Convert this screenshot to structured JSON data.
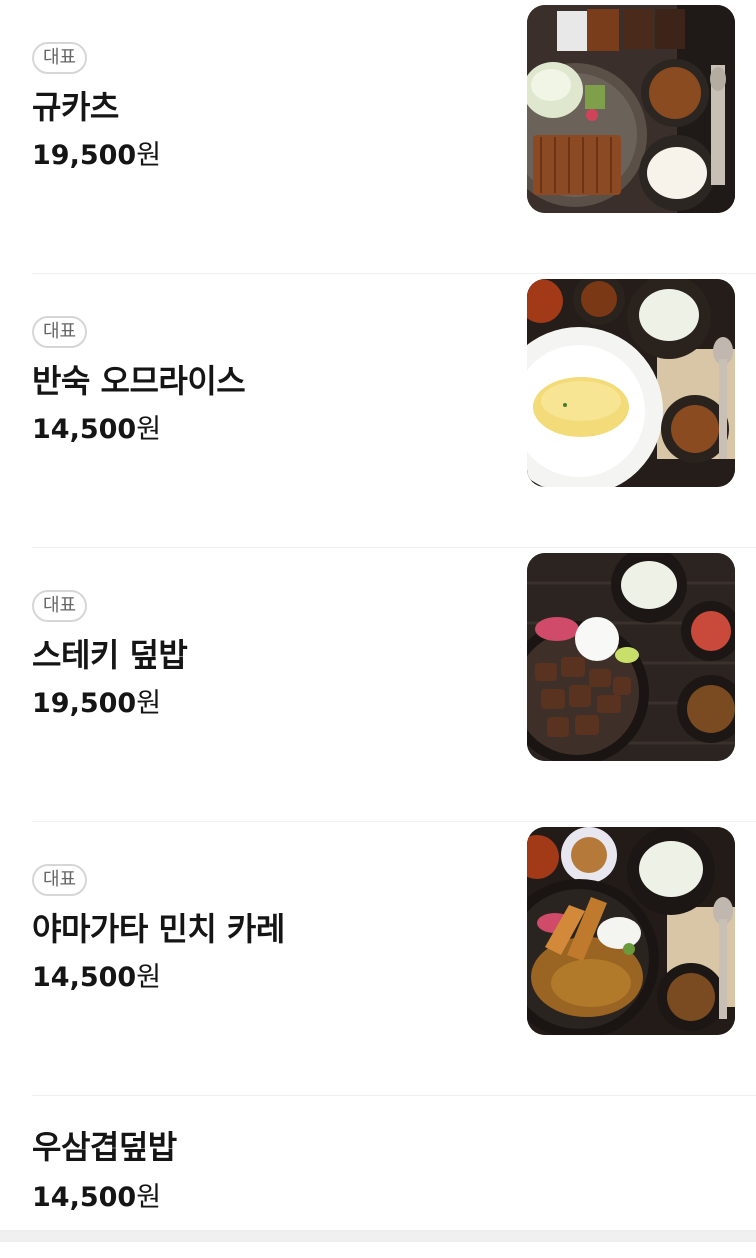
{
  "menu": {
    "items": [
      {
        "badge": "대표",
        "name": "규카츠",
        "price_number": "19,500",
        "price_unit": "원",
        "image": "gyukatsu-set-photo"
      },
      {
        "badge": "대표",
        "name": "반숙 오므라이스",
        "price_number": "14,500",
        "price_unit": "원",
        "image": "omurice-set-photo"
      },
      {
        "badge": "대표",
        "name": "스테키 덮밥",
        "price_number": "19,500",
        "price_unit": "원",
        "image": "steak-donburi-set-photo"
      },
      {
        "badge": "대표",
        "name": "야마가타 민치 카레",
        "price_number": "14,500",
        "price_unit": "원",
        "image": "mince-curry-set-photo"
      },
      {
        "name": "우삼겹덮밥",
        "price_number": "14,500",
        "price_unit": "원"
      }
    ]
  },
  "colors": {
    "text": "#151515",
    "badge_border": "#d6d6d6",
    "badge_text": "#666666",
    "divider": "#efefef",
    "footer": "#f0f0f0"
  }
}
